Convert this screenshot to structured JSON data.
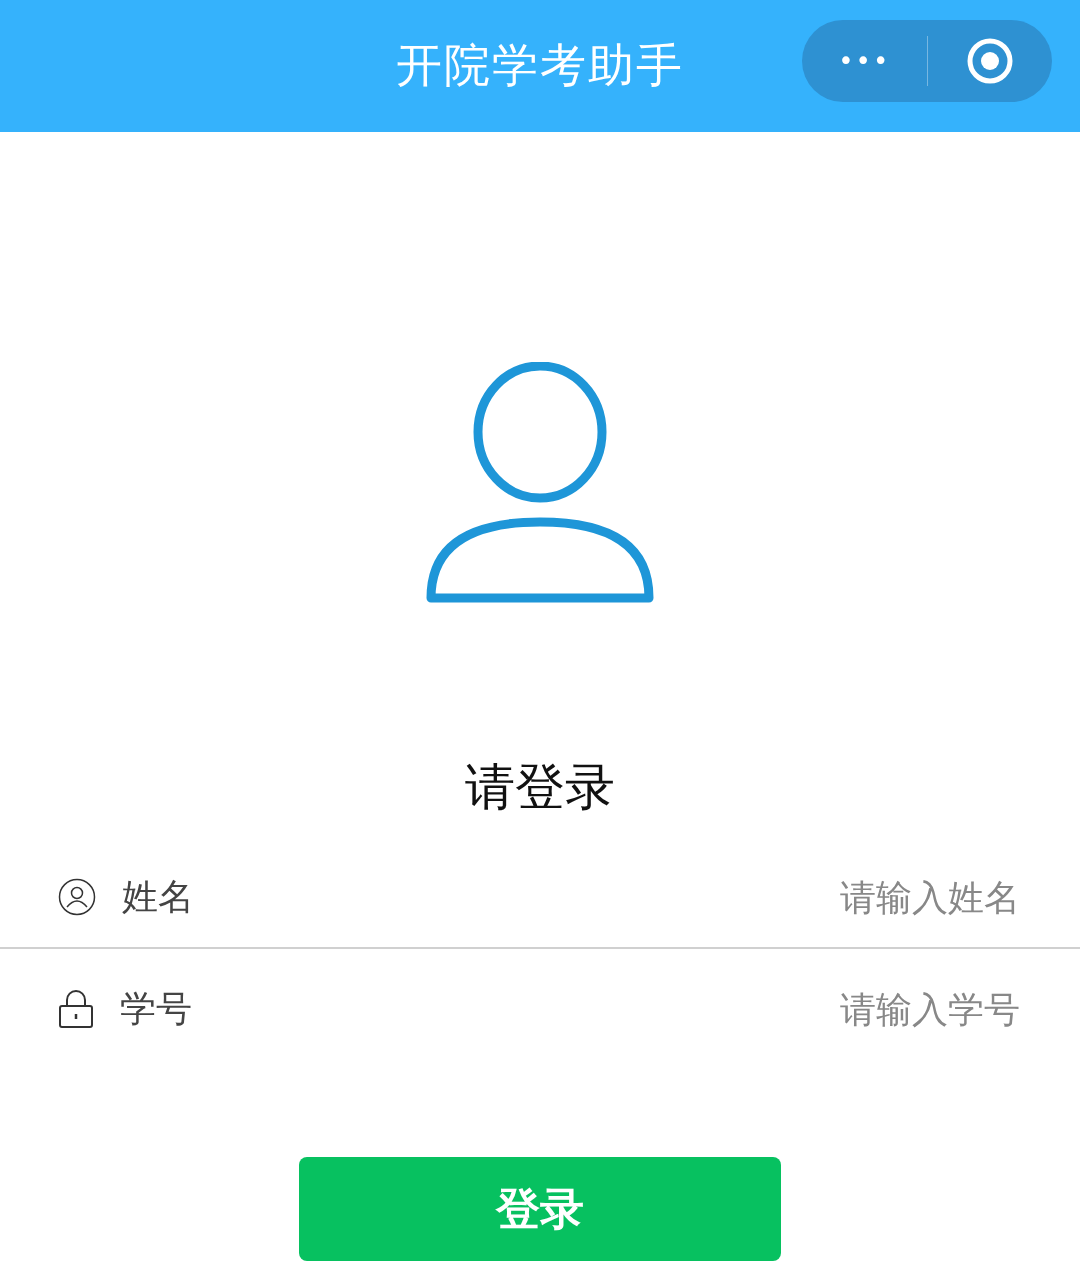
{
  "nav_bar": {
    "title": "开院学考助手",
    "more_glyph": "•••"
  },
  "prompt": "请登录",
  "fields": [
    {
      "kind": "person",
      "label": "姓名",
      "placeholder": "请输入姓名"
    },
    {
      "kind": "lock",
      "label": "学号",
      "placeholder": "请输入学号"
    }
  ],
  "login_button": "登录"
}
